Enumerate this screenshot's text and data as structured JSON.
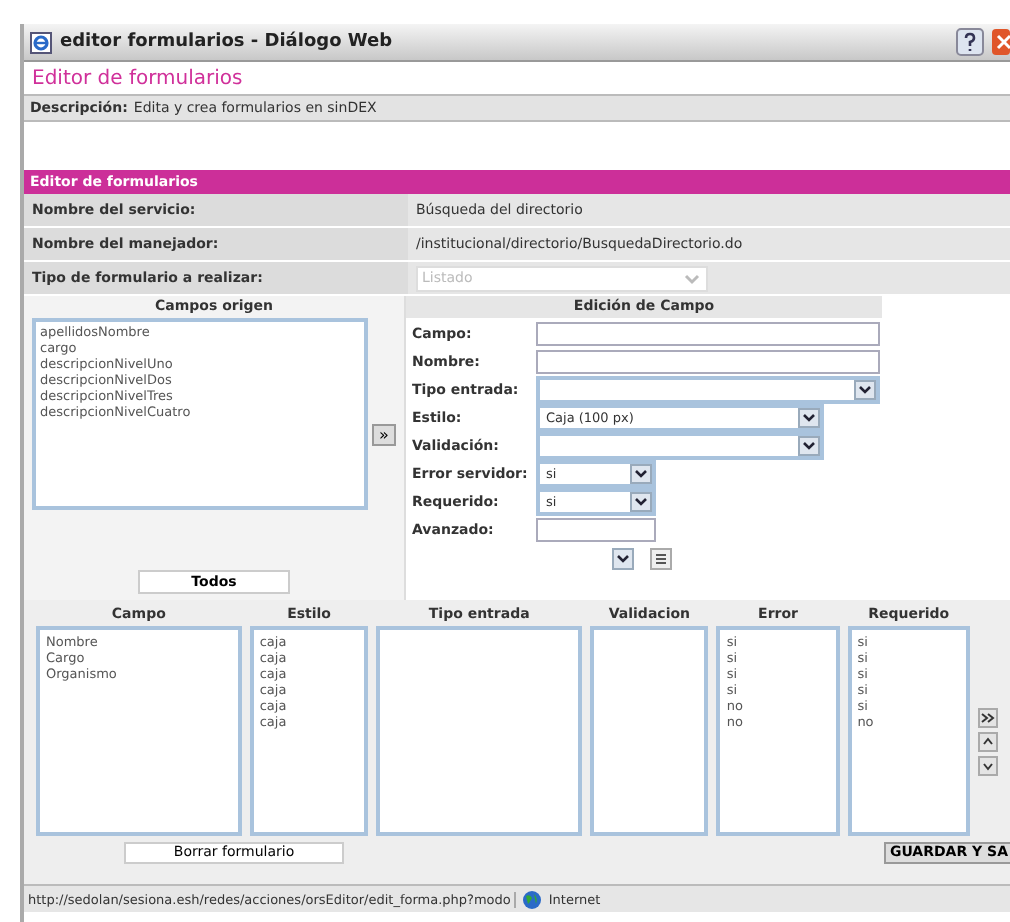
{
  "window": {
    "title": "editor formularios - Diálogo Web"
  },
  "heading": "Editor de formularios",
  "description": {
    "label": "Descripción:",
    "value": "Edita y crea formularios en sinDEX"
  },
  "section_title": "Editor de formularios",
  "info_rows": [
    {
      "label": "Nombre del servicio:",
      "value": "Búsqueda del directorio",
      "kind": "text"
    },
    {
      "label": "Nombre del manejador:",
      "value": "/institucional/directorio/BusquedaDirectorio.do",
      "kind": "text"
    },
    {
      "label": "Tipo de formulario a realizar:",
      "value": "Listado",
      "kind": "select",
      "disabled": true
    }
  ],
  "source_fields": {
    "title": "Campos origen",
    "items": [
      "apellidosNombre",
      "cargo",
      "descripcionNivelUno",
      "descripcionNivelDos",
      "descripcionNivelTres",
      "descripcionNivelCuatro"
    ],
    "move_button": "»",
    "all_button": "Todos"
  },
  "field_editor": {
    "title": "Edición de Campo",
    "fields": [
      {
        "label": "Campo:",
        "kind": "text"
      },
      {
        "label": "Nombre:",
        "kind": "text"
      },
      {
        "label": "Tipo entrada:",
        "kind": "select"
      },
      {
        "label": "Estilo:",
        "kind": "medium",
        "value": "Caja (100 px)"
      },
      {
        "label": "Validación:",
        "kind": "medium"
      },
      {
        "label": "Error servidor:",
        "kind": "small",
        "value": "si"
      },
      {
        "label": "Requerido:",
        "kind": "small",
        "value": "si"
      },
      {
        "label": "Avanzado:",
        "kind": "short"
      }
    ]
  },
  "columns": [
    {
      "title": "Campo",
      "items": [
        "Nombre",
        "Cargo",
        "Organismo"
      ]
    },
    {
      "title": "Estilo",
      "items": [
        "caja",
        "caja",
        "caja",
        "caja",
        "caja",
        "caja"
      ]
    },
    {
      "title": "Tipo entrada"
    },
    {
      "title": "Validacion"
    },
    {
      "title": "Error",
      "items": [
        "si",
        "si",
        "si",
        "si",
        "no",
        "no"
      ]
    },
    {
      "title": "Requerido",
      "items": [
        "si",
        "si",
        "si",
        "si",
        "si",
        "no"
      ]
    }
  ],
  "delete_button": "Borrar formulario",
  "save_button": "GUARDAR Y SA",
  "status_bar": {
    "url": "http://sedolan/sesiona.esh/redes/acciones/orsEditor/edit_forma.php?modo",
    "zone": "Internet"
  }
}
